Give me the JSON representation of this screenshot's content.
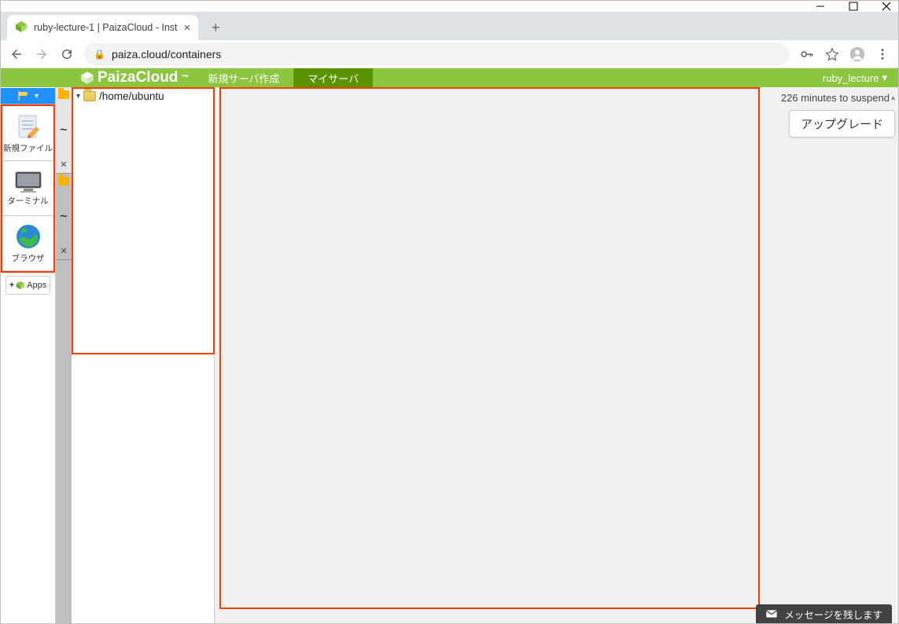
{
  "window": {
    "title": "ruby-lecture-1 | PaizaCloud - Inst"
  },
  "browser": {
    "url": "paiza.cloud/containers"
  },
  "app": {
    "brand": "PaizaCloud",
    "tm": "™",
    "menu_new_server": "新規サーバ作成",
    "menu_my_server": "マイサーバ",
    "user": "ruby_lecture"
  },
  "tools": {
    "new_file": "新規ファイル",
    "terminal": "ターミナル",
    "browser": "ブラウザ",
    "apps": "Apps"
  },
  "explorer": {
    "path": "/home/ubuntu"
  },
  "right": {
    "suspend": "226 minutes to suspend",
    "upgrade": "アップグレード"
  },
  "footer": {
    "message": "メッセージを残します"
  }
}
